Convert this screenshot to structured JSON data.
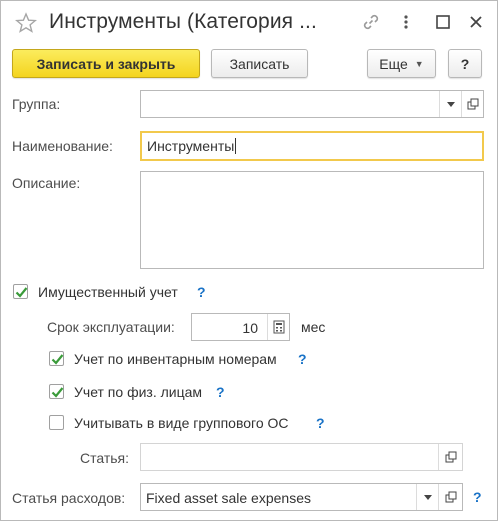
{
  "window": {
    "title": "Инструменты (Категория ...",
    "favorite_icon": "star-icon",
    "link_icon": "link-icon",
    "more_icon": "vertical-dots-icon",
    "maximize_icon": "maximize-icon",
    "close_icon": "close-icon"
  },
  "toolbar": {
    "save_close_label": "Записать и закрыть",
    "save_label": "Записать",
    "more_label": "Еще",
    "help_label": "?"
  },
  "form": {
    "group_label": "Группа:",
    "group_value": "",
    "name_label": "Наименование:",
    "name_value": "Инструменты",
    "description_label": "Описание:",
    "description_value": "",
    "property_accounting_label": "Имущественный учет",
    "property_accounting_checked": true,
    "service_life_label": "Срок эксплуатации:",
    "service_life_value": "10",
    "service_life_unit": "мес",
    "inventory_numbers_label": "Учет по инвентарным номерам",
    "inventory_numbers_checked": true,
    "individuals_label": "Учет по физ. лицам",
    "individuals_checked": true,
    "group_os_label": "Учитывать в виде группового ОС",
    "group_os_checked": false,
    "article_label": "Статья:",
    "article_value": "",
    "expense_article_label": "Статья расходов:",
    "expense_article_value": "Fixed asset sale expenses",
    "help_mark": "?"
  },
  "colors": {
    "primary_button": "#f4d41f",
    "active_field_border": "#f2c94c",
    "help_link": "#1a73c7",
    "checkmark": "#3a9b3a"
  }
}
